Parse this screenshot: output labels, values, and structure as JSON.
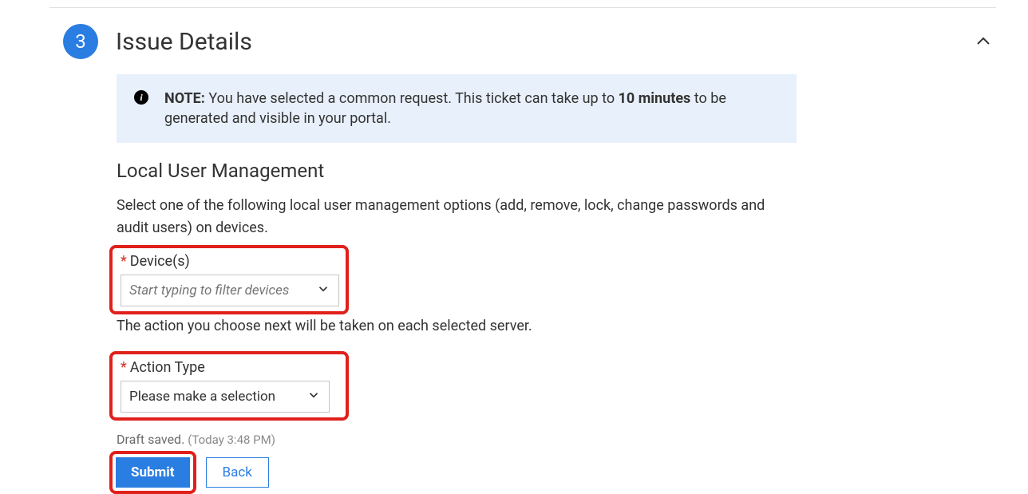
{
  "step": {
    "number": "3",
    "title": "Issue Details"
  },
  "banner": {
    "note_label": "NOTE:",
    "text_before": " You have selected a common request. This ticket can take up to ",
    "emphasis": "10 minutes",
    "text_after": " to be generated and visible in your portal."
  },
  "subsection": {
    "title": "Local User Management",
    "description": "Select one of the following local user management options (add, remove, lock, change passwords and audit users) on devices."
  },
  "devices": {
    "label": "Device(s)",
    "placeholder": "Start typing to filter devices"
  },
  "helper": "The action you choose next will be taken on each selected server.",
  "action_type": {
    "label": "Action Type",
    "placeholder": "Please make a selection"
  },
  "draft": {
    "saved_label": "Draft saved.",
    "timestamp": "(Today 3:48 PM)"
  },
  "buttons": {
    "submit": "Submit",
    "back": "Back"
  }
}
